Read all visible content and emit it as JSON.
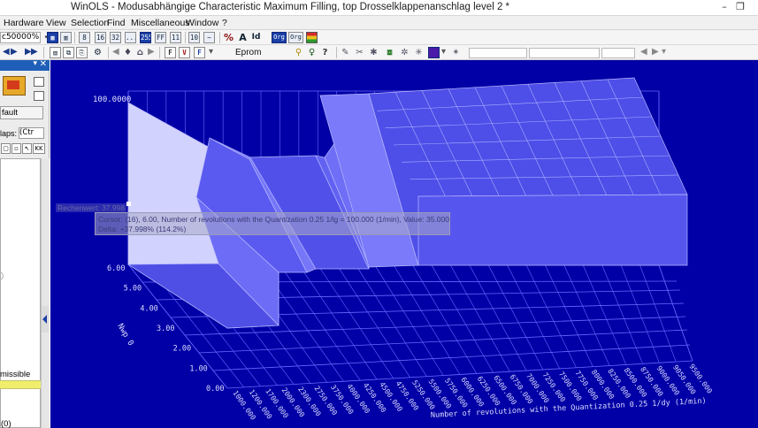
{
  "window": {
    "title": "WinOLS - Modusabhängige Characteristic Maximum Filling, top Drosselklappenanschlag level 2 *",
    "min_label": "–",
    "max_label": "❐"
  },
  "menu": {
    "items": [
      "Hardware",
      "View",
      "Selection",
      "Find",
      "Miscellaneous",
      "Window",
      "?"
    ]
  },
  "toolbar1": {
    "zoom_value": "c50000%",
    "buttons": [
      "8",
      "16",
      "32",
      "...",
      "255",
      "FF",
      "11",
      "10",
      "~",
      "%",
      "A",
      "Id",
      "Org",
      "Org"
    ]
  },
  "toolbar2": {
    "eprom_label": "Eprom"
  },
  "left_panel": {
    "default_label": "fault",
    "maps_label": "laps:",
    "maps_select": "(Ctr",
    "permissible_text": "missible",
    "bottom_count": "(0)"
  },
  "view3d": {
    "z_axis_top_label": "100.0000",
    "y_tick_labels": [
      "0.00",
      "1.00",
      "2.00",
      "3.00",
      "4.00",
      "5.00",
      "6.00"
    ],
    "y_axis_label": "Nwp 0",
    "x_tick_labels": [
      "1000.000",
      "1200.000",
      "1700.000",
      "2000.000",
      "2300.000",
      "2750.000",
      "3750.000",
      "4000.000",
      "4250.000",
      "4500.000",
      "4750.000",
      "5250.000",
      "5500.000",
      "5750.000",
      "6000.000",
      "6250.000",
      "6500.000",
      "6750.000",
      "7000.000",
      "7250.000",
      "7500.000",
      "7750.000",
      "8000.000",
      "8250.000",
      "8500.000",
      "8750.000",
      "9000.000",
      "9050.000",
      "9500.000"
    ],
    "x_axis_label": "Number of revolutions with the Quantization 0.25 1/dy (1/min)",
    "cursor_line": "Cursor: (16), 6.00, Number of revolutions with the Quantization 0.25 1/lg = 100.000 (1/min), Value: 35.000",
    "delta_line": "Delta: +37.998% (114.2%)",
    "tooltip_head": "Rechenwert: 37.998"
  },
  "colors": {
    "background": "#0000a6",
    "surface": "#5a5af2",
    "surface_front": "#c8c8ff",
    "grid": "#6868ff"
  }
}
